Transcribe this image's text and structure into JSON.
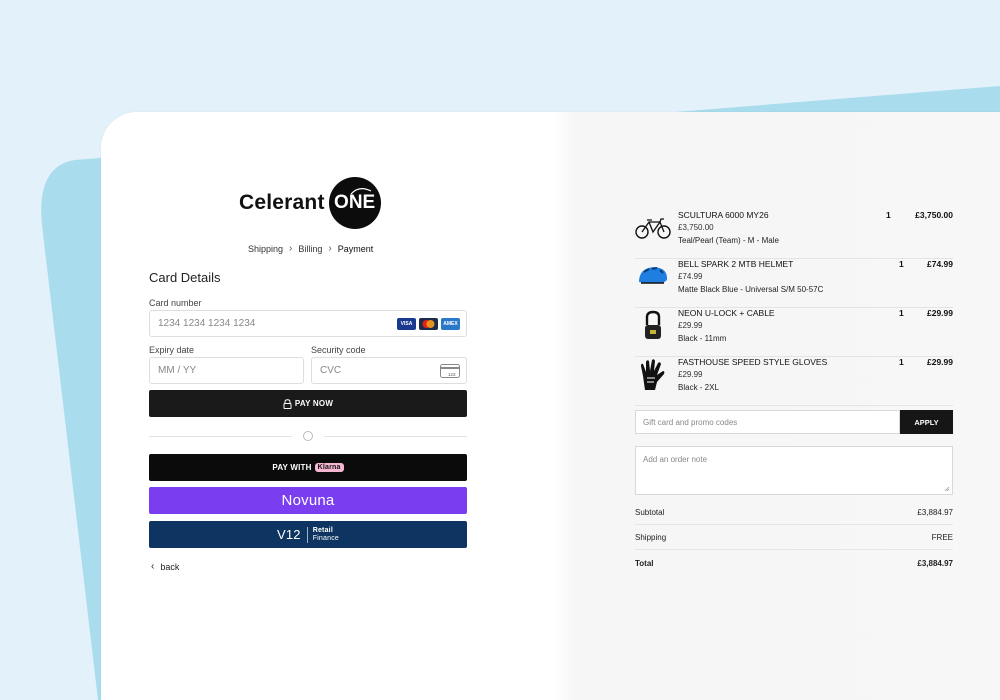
{
  "brand": {
    "name": "Celerant",
    "badge": "ONE"
  },
  "breadcrumb": {
    "step1": "Shipping",
    "step2": "Billing",
    "step3": "Payment",
    "sep": "›"
  },
  "card_details": {
    "title": "Card Details",
    "card_number_label": "Card number",
    "card_number_placeholder": "1234 1234 1234 1234",
    "expiry_label": "Expiry date",
    "expiry_placeholder": "MM / YY",
    "security_label": "Security code",
    "security_placeholder": "CVC",
    "cvc_icon_text": "123",
    "brands": {
      "visa": "VISA",
      "amex": "AMEX"
    }
  },
  "buttons": {
    "pay_now": "PAY NOW",
    "pay_with": "PAY WITH",
    "klarna": "Klarna",
    "novuna": "Novuna",
    "v12_logo": "V12",
    "v12_line1": "Retail",
    "v12_line2": "Finance"
  },
  "back": {
    "label": "back"
  },
  "items": [
    {
      "name": "SCULTURA 6000 MY26",
      "price": "£3,750.00",
      "variant": "Teal/Pearl (Team) - M - Male",
      "qty": "1",
      "total": "£3,750.00",
      "icon": "bicycle-icon"
    },
    {
      "name": "BELL SPARK 2 MTB HELMET",
      "price": "£74.99",
      "variant": "Matte Black Blue - Universal S/M 50-57C",
      "qty": "1",
      "total": "£74.99",
      "icon": "helmet-icon"
    },
    {
      "name": "NEON U-LOCK + CABLE",
      "price": "£29.99",
      "variant": "Black - 11mm",
      "qty": "1",
      "total": "£29.99",
      "icon": "lock-icon"
    },
    {
      "name": "FASTHOUSE SPEED STYLE GLOVES",
      "price": "£29.99",
      "variant": "Black - 2XL",
      "qty": "1",
      "total": "£29.99",
      "icon": "gloves-icon"
    }
  ],
  "promo": {
    "placeholder": "Gift card and promo codes",
    "apply": "APPLY"
  },
  "note": {
    "placeholder": "Add an order note"
  },
  "summary": {
    "subtotal_label": "Subtotal",
    "subtotal_value": "£3,884.97",
    "shipping_label": "Shipping",
    "shipping_value": "FREE",
    "total_label": "Total",
    "total_value": "£3,884.97"
  },
  "colors": {
    "novuna": "#7a3df0",
    "v12": "#0e3561",
    "klarna_pill": "#f5b6d2",
    "background": "#e3f1fb"
  }
}
